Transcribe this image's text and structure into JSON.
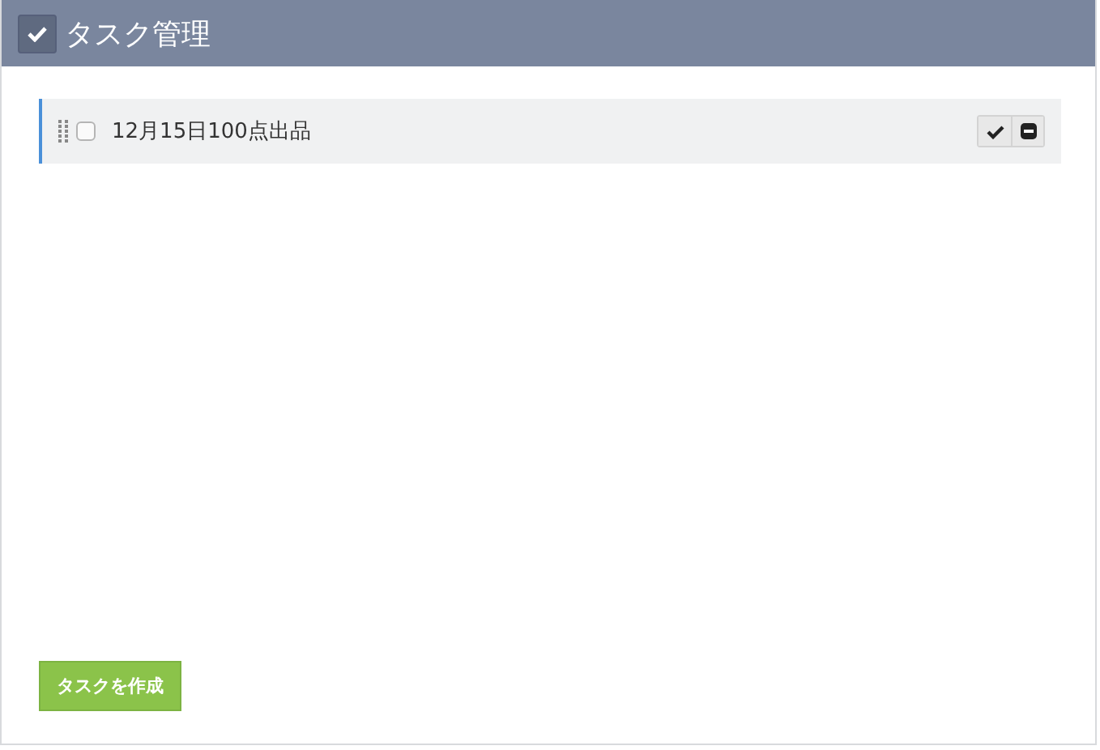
{
  "panel": {
    "title": "タスク管理"
  },
  "tasks": [
    {
      "label": "12月15日100点出品",
      "checked": false
    }
  ],
  "create_button": "タスクを作成"
}
